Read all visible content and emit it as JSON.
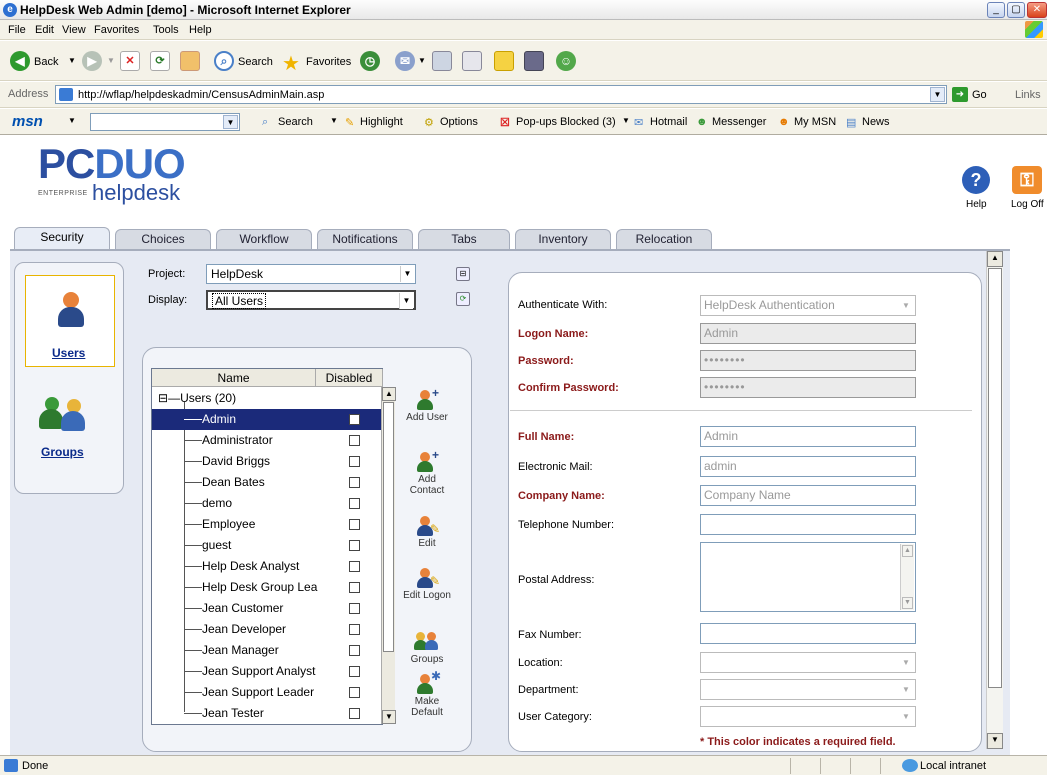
{
  "window": {
    "title": "HelpDesk Web Admin [demo] - Microsoft Internet Explorer"
  },
  "menu": [
    "File",
    "Edit",
    "View",
    "Favorites",
    "Tools",
    "Help"
  ],
  "nav": {
    "back": "Back",
    "search": "Search",
    "favorites": "Favorites"
  },
  "address": {
    "label": "Address",
    "url": "http://wflap/helpdeskadmin/CensusAdminMain.asp",
    "go": "Go",
    "links": "Links"
  },
  "msnbar": {
    "logo": "msn",
    "search": "Search",
    "highlight": "Highlight",
    "options": "Options",
    "popups": "Pop-ups Blocked (3)",
    "hotmail": "Hotmail",
    "messenger": "Messenger",
    "mymsn": "My MSN",
    "news": "News"
  },
  "header": {
    "logo_pc": "PC",
    "logo_duo": "DUO",
    "logo_enterprise": "ENTERPRISE",
    "logo_helpdesk": "helpdesk",
    "help_label": "Help",
    "logoff_label": "Log Off"
  },
  "tabs": [
    "Security",
    "Choices",
    "Workflow",
    "Notifications",
    "Tabs",
    "Inventory",
    "Relocation"
  ],
  "sidebar": {
    "users": "Users",
    "groups": "Groups"
  },
  "filters": {
    "project_label": "Project:",
    "project_value": "HelpDesk",
    "display_label": "Display:",
    "display_value": "All Users"
  },
  "userlist": {
    "col_name": "Name",
    "col_disabled": "Disabled",
    "root": "Users (20)",
    "users": [
      {
        "name": "Admin",
        "disabled": false,
        "selected": true
      },
      {
        "name": "Administrator",
        "disabled": false
      },
      {
        "name": "David Briggs",
        "disabled": false
      },
      {
        "name": "Dean Bates",
        "disabled": false
      },
      {
        "name": "demo",
        "disabled": false
      },
      {
        "name": "Employee",
        "disabled": false
      },
      {
        "name": "guest",
        "disabled": false
      },
      {
        "name": "Help Desk Analyst",
        "disabled": false
      },
      {
        "name": "Help Desk Group Lea",
        "disabled": false
      },
      {
        "name": "Jean Customer",
        "disabled": false
      },
      {
        "name": "Jean Developer",
        "disabled": false
      },
      {
        "name": "Jean Manager",
        "disabled": false
      },
      {
        "name": "Jean Support Analyst",
        "disabled": false
      },
      {
        "name": "Jean Support Leader",
        "disabled": false
      },
      {
        "name": "Jean Tester",
        "disabled": false
      }
    ]
  },
  "actions": {
    "add_user": "Add User",
    "add_contact": "Add Contact",
    "edit": "Edit",
    "edit_logon": "Edit Logon",
    "groups": "Groups",
    "make_default": "Make Default"
  },
  "form": {
    "auth_label": "Authenticate With:",
    "auth_value": "HelpDesk Authentication",
    "logon_label": "Logon Name:",
    "logon_value": "Admin",
    "password_label": "Password:",
    "password_value": "••••••••",
    "confirm_label": "Confirm Password:",
    "confirm_value": "••••••••",
    "fullname_label": "Full Name:",
    "fullname_value": "Admin",
    "email_label": "Electronic Mail:",
    "email_value": "admin",
    "company_label": "Company Name:",
    "company_value": "Company Name",
    "phone_label": "Telephone Number:",
    "postal_label": "Postal Address:",
    "fax_label": "Fax Number:",
    "location_label": "Location:",
    "department_label": "Department:",
    "category_label": "User Category:",
    "required_note": "* This color indicates a required field."
  },
  "status": {
    "text": "Done",
    "zone": "Local intranet"
  }
}
